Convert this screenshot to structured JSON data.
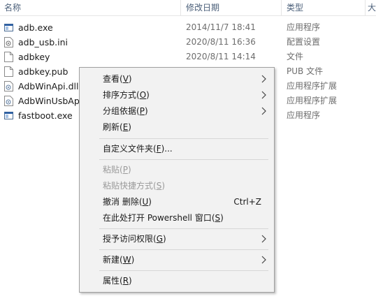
{
  "header": {
    "name": "名称",
    "date": "修改日期",
    "type": "类型",
    "size": "大"
  },
  "files": [
    {
      "name": "adb.exe",
      "date": "2014/11/7 18:41",
      "type": "应用程序",
      "icon": "exe-icon"
    },
    {
      "name": "adb_usb.ini",
      "date": "2020/8/11 16:36",
      "type": "配置设置",
      "icon": "ini-file-icon"
    },
    {
      "name": "adbkey",
      "date": "2020/8/11 14:14",
      "type": "文件",
      "icon": "file-icon"
    },
    {
      "name": "adbkey.pub",
      "date": "",
      "type": "PUB 文件",
      "icon": "file-icon"
    },
    {
      "name": "AdbWinApi.dll",
      "date": "",
      "type": "应用程序扩展",
      "icon": "dll-icon"
    },
    {
      "name": "AdbWinUsbAp",
      "date": "",
      "type": "应用程序扩展",
      "icon": "dll-icon"
    },
    {
      "name": "fastboot.exe",
      "date": "",
      "type": "应用程序",
      "icon": "exe-icon"
    }
  ],
  "menu": {
    "items": [
      {
        "label": "查看(V)",
        "pre": "查看(",
        "key": "V",
        "post": ")",
        "submenu": true,
        "disabled": false
      },
      {
        "label": "排序方式(O)",
        "pre": "排序方式(",
        "key": "O",
        "post": ")",
        "submenu": true,
        "disabled": false
      },
      {
        "label": "分组依据(P)",
        "pre": "分组依据(",
        "key": "P",
        "post": ")",
        "submenu": true,
        "disabled": false
      },
      {
        "label": "刷新(E)",
        "pre": "刷新(",
        "key": "E",
        "post": ")",
        "submenu": false,
        "disabled": false
      },
      {
        "label": "自定义文件夹(F)...",
        "pre": "自定义文件夹(",
        "key": "F",
        "post": ")...",
        "submenu": false,
        "disabled": false
      },
      {
        "label": "粘贴(P)",
        "pre": "粘贴(",
        "key": "P",
        "post": ")",
        "submenu": false,
        "disabled": true
      },
      {
        "label": "粘贴快捷方式(S)",
        "pre": "粘贴快捷方式(",
        "key": "S",
        "post": ")",
        "submenu": false,
        "disabled": true
      },
      {
        "label": "撤消 删除(U)",
        "pre": "撤消 删除(",
        "key": "U",
        "post": ")",
        "submenu": false,
        "disabled": false,
        "shortcut": "Ctrl+Z"
      },
      {
        "label": "在此处打开 Powershell 窗口(S)",
        "pre": "在此处打开 Powershell 窗口(",
        "key": "S",
        "post": ")",
        "submenu": false,
        "disabled": false
      },
      {
        "label": "授予访问权限(G)",
        "pre": "授予访问权限(",
        "key": "G",
        "post": ")",
        "submenu": true,
        "disabled": false
      },
      {
        "label": "新建(W)",
        "pre": "新建(",
        "key": "W",
        "post": ")",
        "submenu": true,
        "disabled": false
      },
      {
        "label": "属性(R)",
        "pre": "属性(",
        "key": "R",
        "post": ")",
        "submenu": false,
        "disabled": false
      }
    ]
  },
  "colors": {
    "header_text": "#4c607a",
    "menu_bg": "#f2f2f2",
    "disabled_text": "#9a9a9a"
  }
}
